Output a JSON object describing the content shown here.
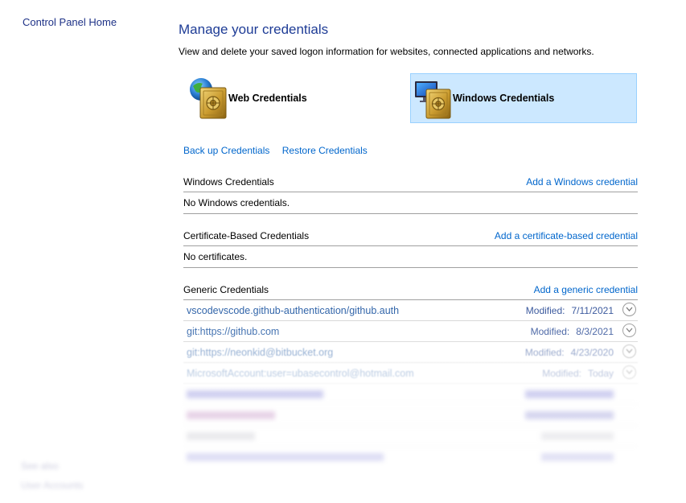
{
  "sidebar": {
    "home": "Control Panel Home",
    "see_also": "See also",
    "user_accounts": "User Accounts"
  },
  "page": {
    "title": "Manage your credentials",
    "description": "View and delete your saved logon information for websites, connected applications and networks."
  },
  "tiles": {
    "web": "Web Credentials",
    "windows": "Windows Credentials",
    "selected": "windows"
  },
  "actions": {
    "backup": "Back up Credentials",
    "restore": "Restore Credentials"
  },
  "sections": {
    "windows": {
      "heading": "Windows Credentials",
      "add": "Add a Windows credential",
      "empty": "No Windows credentials."
    },
    "certificate": {
      "heading": "Certificate-Based Credentials",
      "add": "Add a certificate-based credential",
      "empty": "No certificates."
    },
    "generic": {
      "heading": "Generic Credentials",
      "add": "Add a generic credential",
      "items": [
        {
          "name": "vscodevscode.github-authentication/github.auth",
          "modified_label": "Modified:",
          "modified": "7/11/2021"
        },
        {
          "name": "git:https://github.com",
          "modified_label": "Modified:",
          "modified": "8/3/2021"
        },
        {
          "name": "git:https://neonkid@bitbucket.org",
          "modified_label": "Modified:",
          "modified": "4/23/2020"
        },
        {
          "name": "MicrosoftAccount:user=ubasecontrol@hotmail.com",
          "modified_label": "Modified:",
          "modified": "Today"
        },
        {
          "name": "",
          "modified_label": "",
          "modified": ""
        },
        {
          "name": "",
          "modified_label": "",
          "modified": ""
        },
        {
          "name": "",
          "modified_label": "",
          "modified": ""
        },
        {
          "name": "",
          "modified_label": "",
          "modified": ""
        }
      ]
    }
  },
  "colors": {
    "link": "#0066cc",
    "title": "#1e3c96",
    "selected_tile": "#cce8ff",
    "selected_border": "#99d1ff"
  },
  "icons": {
    "web_tile": "globe-safe-icon",
    "windows_tile": "monitor-safe-icon",
    "expand": "chevron-down-icon"
  }
}
